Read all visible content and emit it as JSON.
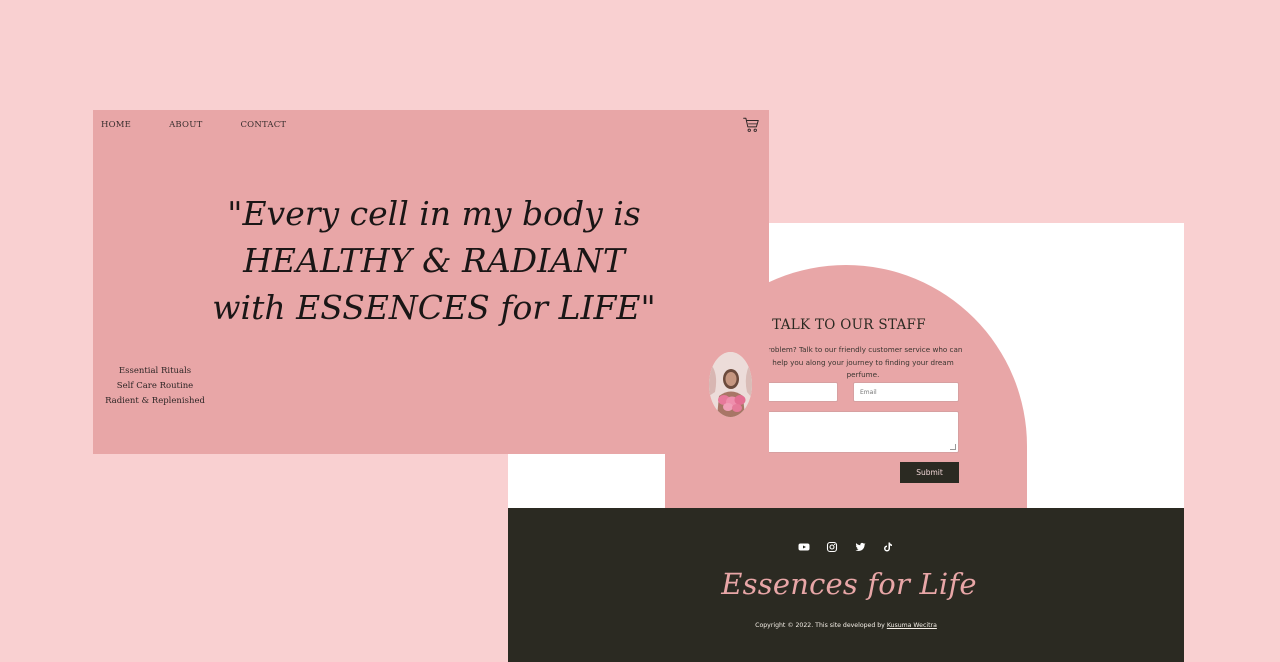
{
  "nav": {
    "items": [
      "HOME",
      "ABOUT",
      "CONTACT"
    ],
    "cart_icon": "cart-icon"
  },
  "hero": {
    "quote_lines": [
      "\"Every cell in my body is",
      "HEALTHY & RADIANT",
      "with ESSENCES for LIFE\""
    ],
    "side_items": [
      "Essential Rituals",
      "Self Care Routine",
      "Radient & Replenished"
    ]
  },
  "contact": {
    "title": "TALK TO OUR STAFF",
    "description": "Problem? Talk to our friendly customer service who can help you along your journey to finding your dream perfume.",
    "name_placeholder": "",
    "email_placeholder": "Email",
    "message_placeholder": "",
    "submit_label": "Submit"
  },
  "footer": {
    "social_icons": [
      "youtube-icon",
      "instagram-icon",
      "twitter-icon",
      "tiktok-icon"
    ],
    "brand": "Essences for Life",
    "copyright_prefix": "Copyright © 2022. This site developed by ",
    "copyright_link": "Kusuma Wecitra"
  },
  "colors": {
    "page_bg": "#f9d0d1",
    "accent_pink": "#e8a6a7",
    "dark": "#2b2a22",
    "white": "#ffffff"
  }
}
